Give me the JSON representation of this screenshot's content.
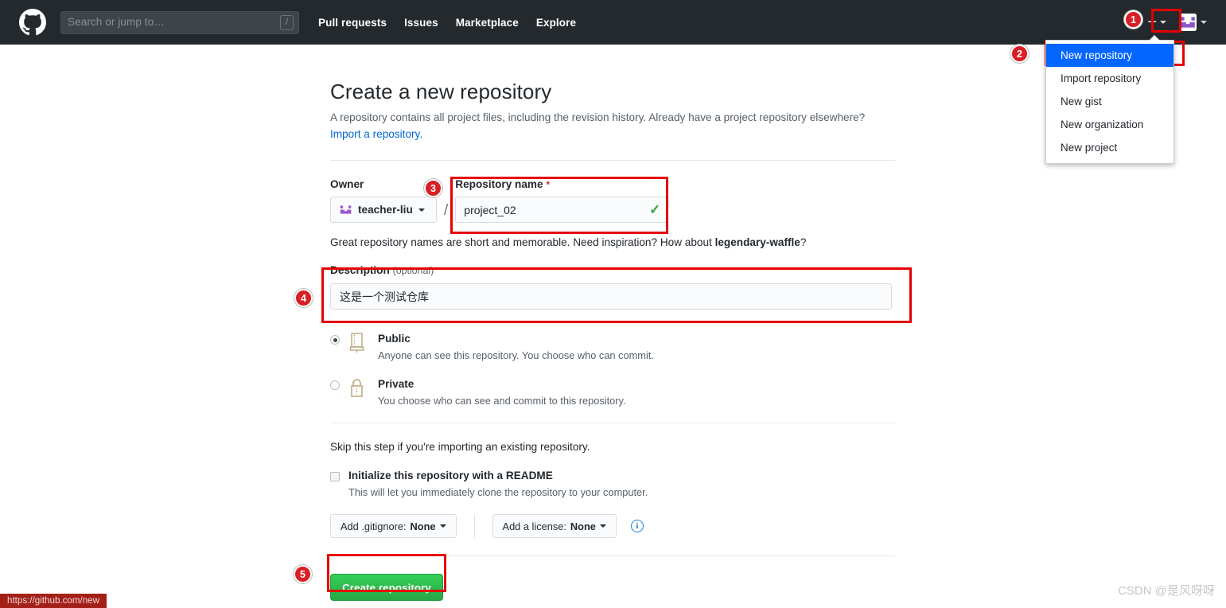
{
  "header": {
    "logo_icon": "github-mark-icon",
    "search": {
      "placeholder": "Search or jump to…",
      "shortcut": "/"
    },
    "nav": [
      {
        "label": "Pull requests"
      },
      {
        "label": "Issues"
      },
      {
        "label": "Marketplace"
      },
      {
        "label": "Explore"
      }
    ],
    "create_new_icon": "plus-icon",
    "create_new_caret_icon": "chevron-down-icon",
    "avatar_icon": "user-avatar-icon",
    "avatar_caret_icon": "chevron-down-icon"
  },
  "dropdown": {
    "items": [
      {
        "label": "New repository",
        "active": true
      },
      {
        "label": "Import repository",
        "active": false
      },
      {
        "label": "New gist",
        "active": false
      },
      {
        "label": "New organization",
        "active": false
      },
      {
        "label": "New project",
        "active": false
      }
    ]
  },
  "form": {
    "title": "Create a new repository",
    "lede": "A repository contains all project files, including the revision history. Already have a project repository elsewhere?",
    "import_link": "Import a repository.",
    "owner_label": "Owner",
    "owner_value": "teacher-liu",
    "owner_caret_icon": "chevron-down-icon",
    "owner_avatar_icon": "user-avatar-icon",
    "separator": "/",
    "name_label": "Repository name",
    "name_required_mark": "*",
    "name_value": "project_02",
    "name_valid_icon": "check-icon",
    "hint_prefix": "Great repository names are short and memorable. Need inspiration? How about ",
    "hint_suggestion": "legendary-waffle",
    "hint_suffix": "?",
    "description_label": "Description",
    "description_optional": "(optional)",
    "description_value": "这是一个测试仓库",
    "visibility": [
      {
        "title": "Public",
        "subtitle": "Anyone can see this repository. You choose who can commit.",
        "selected": true,
        "icon": "repo-book-icon"
      },
      {
        "title": "Private",
        "subtitle": "You choose who can see and commit to this repository.",
        "selected": false,
        "icon": "lock-icon"
      }
    ],
    "skip_note": "Skip this step if you're importing an existing repository.",
    "readme_label": "Initialize this repository with a README",
    "readme_sub": "This will let you immediately clone the repository to your computer.",
    "readme_checked": false,
    "gitignore_prefix": "Add .gitignore:",
    "gitignore_value": "None",
    "license_prefix": "Add a license:",
    "license_value": "None",
    "info_icon": "info-icon",
    "create_button": "Create repository"
  },
  "annotations": {
    "badges": [
      {
        "num": "1"
      },
      {
        "num": "2"
      },
      {
        "num": "3"
      },
      {
        "num": "4"
      },
      {
        "num": "5"
      }
    ]
  },
  "statusbar": {
    "url": "https://github.com/new"
  },
  "watermark": {
    "text": "CSDN @是风呀呀"
  },
  "colors": {
    "header_bg": "#24292e",
    "accent_blue": "#0366d6",
    "menu_highlight": "#0366ff",
    "annotation_red": "#e60000",
    "success_green": "#28a745",
    "statusbar_bg": "#a32019"
  }
}
